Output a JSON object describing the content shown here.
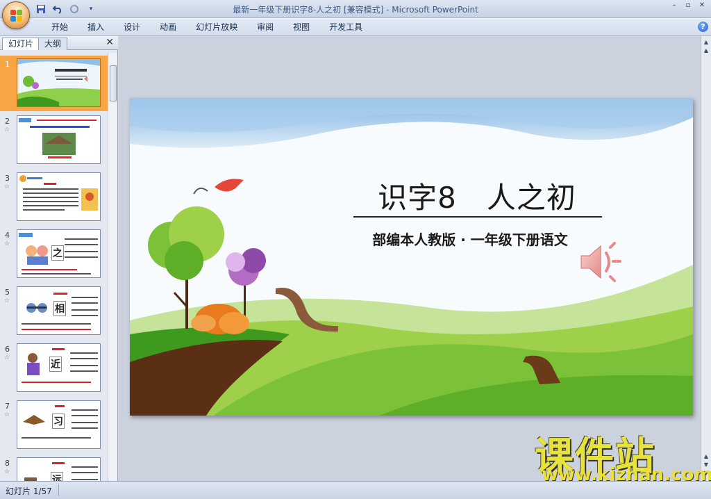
{
  "window": {
    "title": "最新一年级下册识字8-人之初 [兼容模式] - Microsoft PowerPoint",
    "controls": [
      "–",
      "▫",
      "✕"
    ]
  },
  "quick_access": {
    "save": "save-icon",
    "undo": "undo-icon",
    "redo": "redo-icon",
    "customize": "▾"
  },
  "ribbon": {
    "tabs": [
      "开始",
      "插入",
      "设计",
      "动画",
      "幻灯片放映",
      "审阅",
      "视图",
      "开发工具"
    ],
    "help": "?"
  },
  "left_panel": {
    "tabs": [
      "幻灯片",
      "大纲"
    ],
    "close": "✕",
    "slides": [
      {
        "num": "1",
        "char": ""
      },
      {
        "num": "2",
        "char": ""
      },
      {
        "num": "3",
        "char": ""
      },
      {
        "num": "4",
        "char": "之"
      },
      {
        "num": "5",
        "char": "相"
      },
      {
        "num": "6",
        "char": "近"
      },
      {
        "num": "7",
        "char": "习"
      },
      {
        "num": "8",
        "char": "远"
      }
    ],
    "selected_index": 0
  },
  "slide": {
    "title": "识字8　人之初",
    "subtitle": "部编本人教版 · 一年级下册语文",
    "colors": {
      "sky": "#7fb4e4",
      "grass_dark": "#3e9a1e",
      "grass_light": "#9fd04a",
      "path": "#5a2f14"
    }
  },
  "watermark": {
    "brand": "课件站",
    "url": "www.kjzhan.com"
  },
  "status": {
    "slide_indicator": "幻灯片 1/57"
  }
}
